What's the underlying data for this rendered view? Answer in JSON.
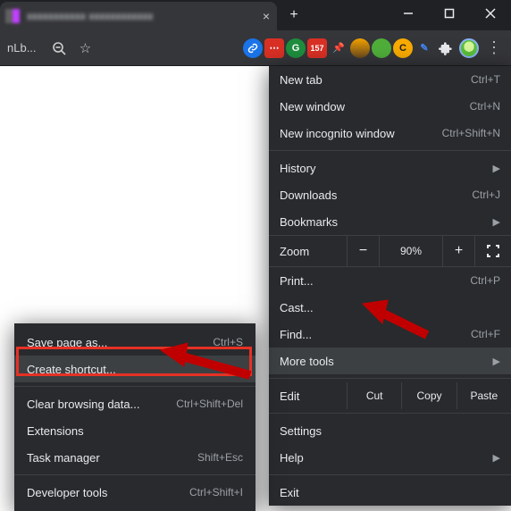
{
  "tab": {
    "title": "xxxxxxxxxxx xxxxxxxxxxxx"
  },
  "address_fragment": "nLb...",
  "gmail_badge": "157",
  "ext_c_label": "C",
  "menu": {
    "new_tab": "New tab",
    "new_tab_sc": "Ctrl+T",
    "new_window": "New window",
    "new_window_sc": "Ctrl+N",
    "incognito": "New incognito window",
    "incognito_sc": "Ctrl+Shift+N",
    "history": "History",
    "downloads": "Downloads",
    "downloads_sc": "Ctrl+J",
    "bookmarks": "Bookmarks",
    "zoom_label": "Zoom",
    "zoom_minus": "−",
    "zoom_pct": "90%",
    "zoom_plus": "+",
    "print": "Print...",
    "print_sc": "Ctrl+P",
    "cast": "Cast...",
    "find": "Find...",
    "find_sc": "Ctrl+F",
    "more_tools": "More tools",
    "edit_label": "Edit",
    "cut": "Cut",
    "copy": "Copy",
    "paste": "Paste",
    "settings": "Settings",
    "help": "Help",
    "exit": "Exit"
  },
  "submenu": {
    "save_page": "Save page as...",
    "save_page_sc": "Ctrl+S",
    "create_shortcut": "Create shortcut...",
    "clear_data": "Clear browsing data...",
    "clear_data_sc": "Ctrl+Shift+Del",
    "extensions": "Extensions",
    "task_manager": "Task manager",
    "task_manager_sc": "Shift+Esc",
    "dev_tools": "Developer tools",
    "dev_tools_sc": "Ctrl+Shift+I"
  }
}
